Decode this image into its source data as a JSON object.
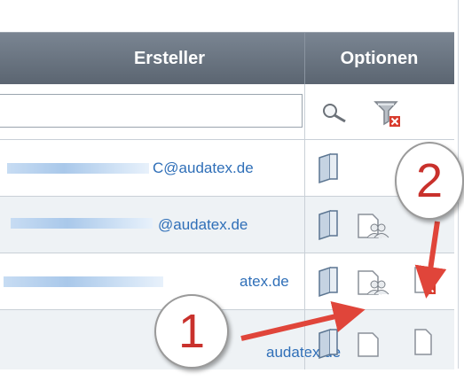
{
  "table": {
    "headers": {
      "creator": "Ersteller",
      "options": "Optionen"
    },
    "rows": [
      {
        "email_suffix": "C@audatex.de"
      },
      {
        "email_suffix": "@audatex.de"
      },
      {
        "email_suffix": "atex.de"
      },
      {
        "email_suffix": "audatex.de"
      }
    ]
  },
  "annotations": {
    "callout_1": "1",
    "callout_2": "2",
    "arrow_color": "#e0453a"
  },
  "icons": [
    "search-icon",
    "filter-clear-icon",
    "open-icon",
    "users-icon",
    "delete-icon"
  ]
}
